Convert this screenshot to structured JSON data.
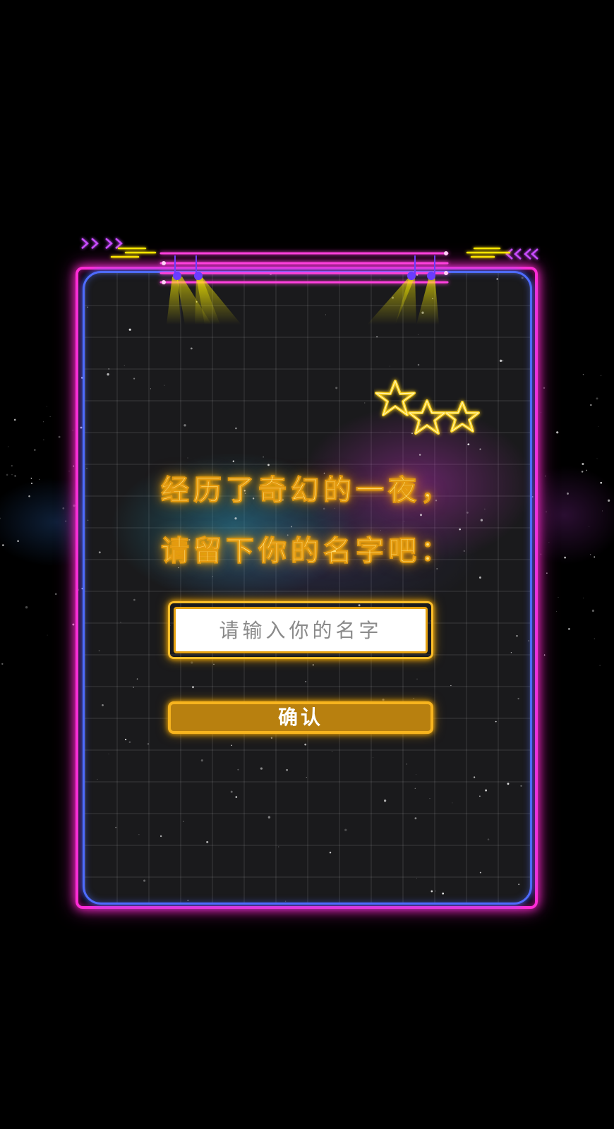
{
  "prompt": {
    "line1": "经历了奇幻的一夜，",
    "line2": "请留下你的名字吧："
  },
  "name_input": {
    "placeholder": "请输入你的名字",
    "value": ""
  },
  "confirm_button": {
    "label": "确认"
  },
  "colors": {
    "background": "#000000",
    "frame_outer": "#ff2bd6",
    "frame_inner": "#4e6bff",
    "grid_panel": "#1a1a1c",
    "neon_yellow": "#ffe27a",
    "neon_orange": "#f7b41e",
    "button_fill": "#b8800f",
    "spotlight_purple": "#6a3cff"
  },
  "icons": {
    "stars": "three-neon-stars-icon",
    "arrows_left": "double-chevron-right-icon",
    "arrows_right": "double-chevron-left-icon",
    "spotlights": "stage-spotlight-icon"
  }
}
